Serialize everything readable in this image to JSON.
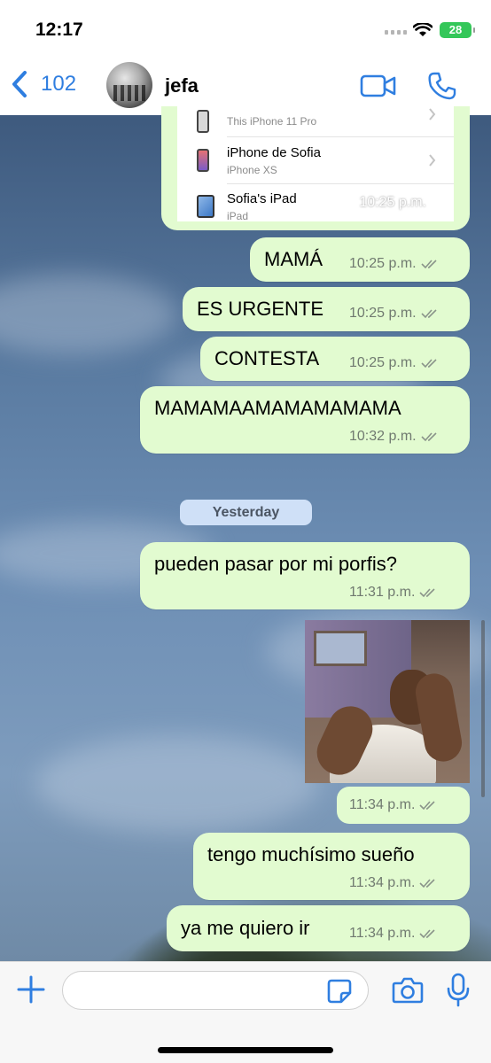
{
  "status_bar": {
    "time": "12:17",
    "battery": "28"
  },
  "header": {
    "back_count": "102",
    "contact_name": "jefa"
  },
  "devices": [
    {
      "name": "",
      "model": "This iPhone 11 Pro"
    },
    {
      "name": "iPhone de Sofia",
      "model": "iPhone XS"
    },
    {
      "name": "Sofia's iPad",
      "model": "iPad"
    }
  ],
  "screenshot_time": "10:25 p.m.",
  "messages": [
    {
      "text": "MAMÁ",
      "time": "10:25 p.m."
    },
    {
      "text": "ES URGENTE",
      "time": "10:25 p.m."
    },
    {
      "text": "CONTESTA",
      "time": "10:25 p.m."
    },
    {
      "text": "MAMAMAAMAMAMAMAMA",
      "time": "10:32 p.m."
    },
    {
      "text": "pueden pasar por mi porfis?",
      "time": "11:31 p.m."
    },
    {
      "text": "tengo muchísimo sueño",
      "time": "11:34 p.m."
    },
    {
      "text": "ya me quiero ir",
      "time": "11:34 p.m."
    }
  ],
  "date_separator": "Yesterday",
  "image_message": {
    "time": "11:34 p.m."
  },
  "composer": {
    "placeholder": ""
  },
  "colors": {
    "outgoing_bubble": "#e2fbd0",
    "accent": "#2f7ee0",
    "read_ticks": "#707a70"
  }
}
